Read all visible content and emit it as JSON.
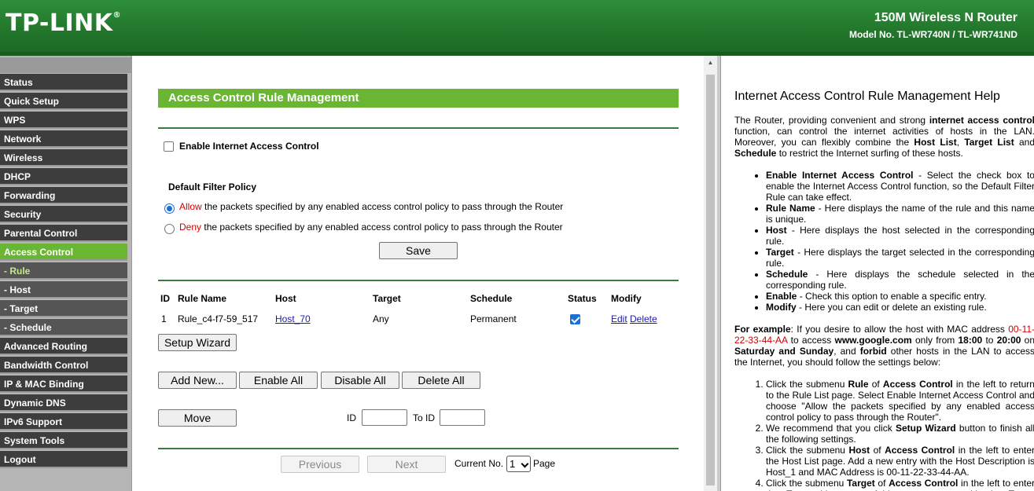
{
  "header": {
    "logo": "TP-LINK",
    "product": "150M Wireless N Router",
    "model": "Model No. TL-WR740N / TL-WR741ND"
  },
  "sidebar": {
    "items": [
      {
        "label": "Status"
      },
      {
        "label": "Quick Setup"
      },
      {
        "label": "WPS"
      },
      {
        "label": "Network"
      },
      {
        "label": "Wireless"
      },
      {
        "label": "DHCP"
      },
      {
        "label": "Forwarding"
      },
      {
        "label": "Security"
      },
      {
        "label": "Parental Control"
      },
      {
        "label": "Access Control"
      },
      {
        "label": "- Rule"
      },
      {
        "label": "- Host"
      },
      {
        "label": "- Target"
      },
      {
        "label": "- Schedule"
      },
      {
        "label": "Advanced Routing"
      },
      {
        "label": "Bandwidth Control"
      },
      {
        "label": "IP & MAC Binding"
      },
      {
        "label": "Dynamic DNS"
      },
      {
        "label": "IPv6 Support"
      },
      {
        "label": "System Tools"
      },
      {
        "label": "Logout"
      }
    ]
  },
  "main": {
    "title": "Access Control Rule Management",
    "enable_label": "Enable Internet Access Control",
    "enable_checked": false,
    "policy_label": "Default Filter Policy",
    "allow_word": "Allow",
    "allow_rest": "the packets specified by any enabled access control policy to pass through the Router",
    "deny_word": "Deny",
    "deny_rest": "the packets specified by any enabled access control policy to pass through the Router",
    "selected_policy": "allow",
    "save_label": "Save",
    "table": {
      "headers": [
        "ID",
        "Rule Name",
        "Host",
        "Target",
        "Schedule",
        "Status",
        "Modify"
      ],
      "rows": [
        {
          "id": "1",
          "rule_name": "Rule_c4-f7-59_517",
          "host": "Host_70",
          "target": "Any",
          "schedule": "Permanent",
          "status": true,
          "edit": "Edit",
          "delete": "Delete"
        }
      ]
    },
    "setup_wizard_label": "Setup Wizard",
    "add_new_label": "Add New...",
    "enable_all_label": "Enable All",
    "disable_all_label": "Disable All",
    "delete_all_label": "Delete All",
    "move_label": "Move",
    "id_label": "ID",
    "to_id_label": "To ID",
    "previous_label": "Previous",
    "next_label": "Next",
    "current_no_label": "Current No.",
    "current_page": "1",
    "page_label": "Page"
  },
  "help": {
    "title": "Internet Access Control Rule Management Help"
  },
  "colors": {
    "header_green": "#23782c",
    "accent_green": "#6ab534",
    "sidebar_dark": "#3d3d3d",
    "link_blue": "#1b1ba8",
    "warning_red": "#d40000"
  }
}
